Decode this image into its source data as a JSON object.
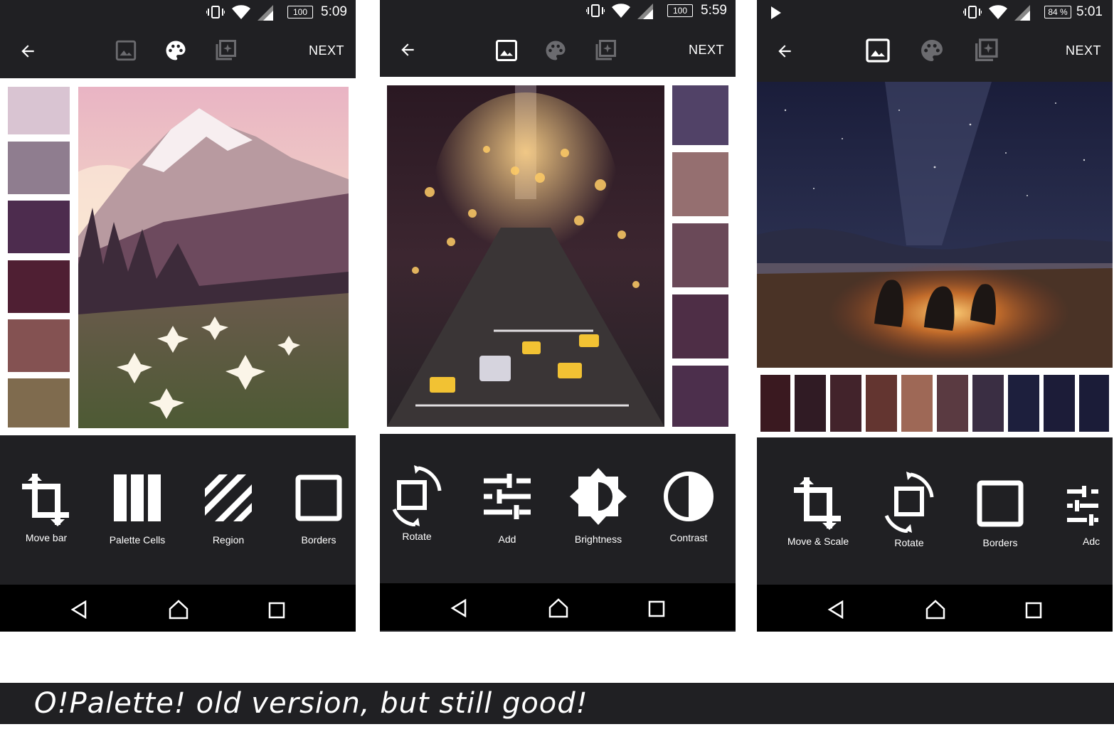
{
  "colors": {
    "panel": "#202023",
    "nav": "#000000"
  },
  "phones": [
    {
      "status": {
        "time": "5:09",
        "battery": "100"
      },
      "toolbar": {
        "next_label": "NEXT",
        "active_tab": "palette"
      },
      "palette": [
        "#d9c4d2",
        "#8f7d8f",
        "#4d2c4e",
        "#4f1f33",
        "#845252",
        "#7f6b4e"
      ],
      "tools": [
        {
          "label": "Move bar",
          "icon": "crop-icon"
        },
        {
          "label": "Palette Cells",
          "icon": "palette-cells-icon"
        },
        {
          "label": "Region",
          "icon": "region-icon"
        },
        {
          "label": "Borders",
          "icon": "borders-icon"
        }
      ]
    },
    {
      "status": {
        "time": "5:59",
        "battery": "100"
      },
      "toolbar": {
        "next_label": "NEXT",
        "active_tab": "image"
      },
      "palette": [
        "#514267",
        "#956f70",
        "#6a4958",
        "#4e2e46",
        "#4c2f4c"
      ],
      "tools": [
        {
          "label": "Rotate",
          "icon": "rotate-icon"
        },
        {
          "label": "Add",
          "icon": "tune-icon"
        },
        {
          "label": "Brightness",
          "icon": "brightness-icon"
        },
        {
          "label": "Contrast",
          "icon": "contrast-icon"
        }
      ]
    },
    {
      "status": {
        "time": "5:01",
        "battery": "84 %"
      },
      "toolbar": {
        "next_label": "NEXT",
        "active_tab": "image"
      },
      "palette": [
        "#3a1920",
        "#301b24",
        "#42232b",
        "#633530",
        "#9e6856",
        "#5a3a41",
        "#3a2e43",
        "#1d1f3d",
        "#1c1c38",
        "#1b1c38"
      ],
      "tools": [
        {
          "label": "Move & Scale",
          "icon": "crop-icon"
        },
        {
          "label": "Rotate",
          "icon": "rotate-icon"
        },
        {
          "label": "Borders",
          "icon": "borders-icon"
        },
        {
          "label": "Adc",
          "icon": "tune-icon"
        }
      ]
    }
  ],
  "caption": "O!Palette! old version, but still good!"
}
